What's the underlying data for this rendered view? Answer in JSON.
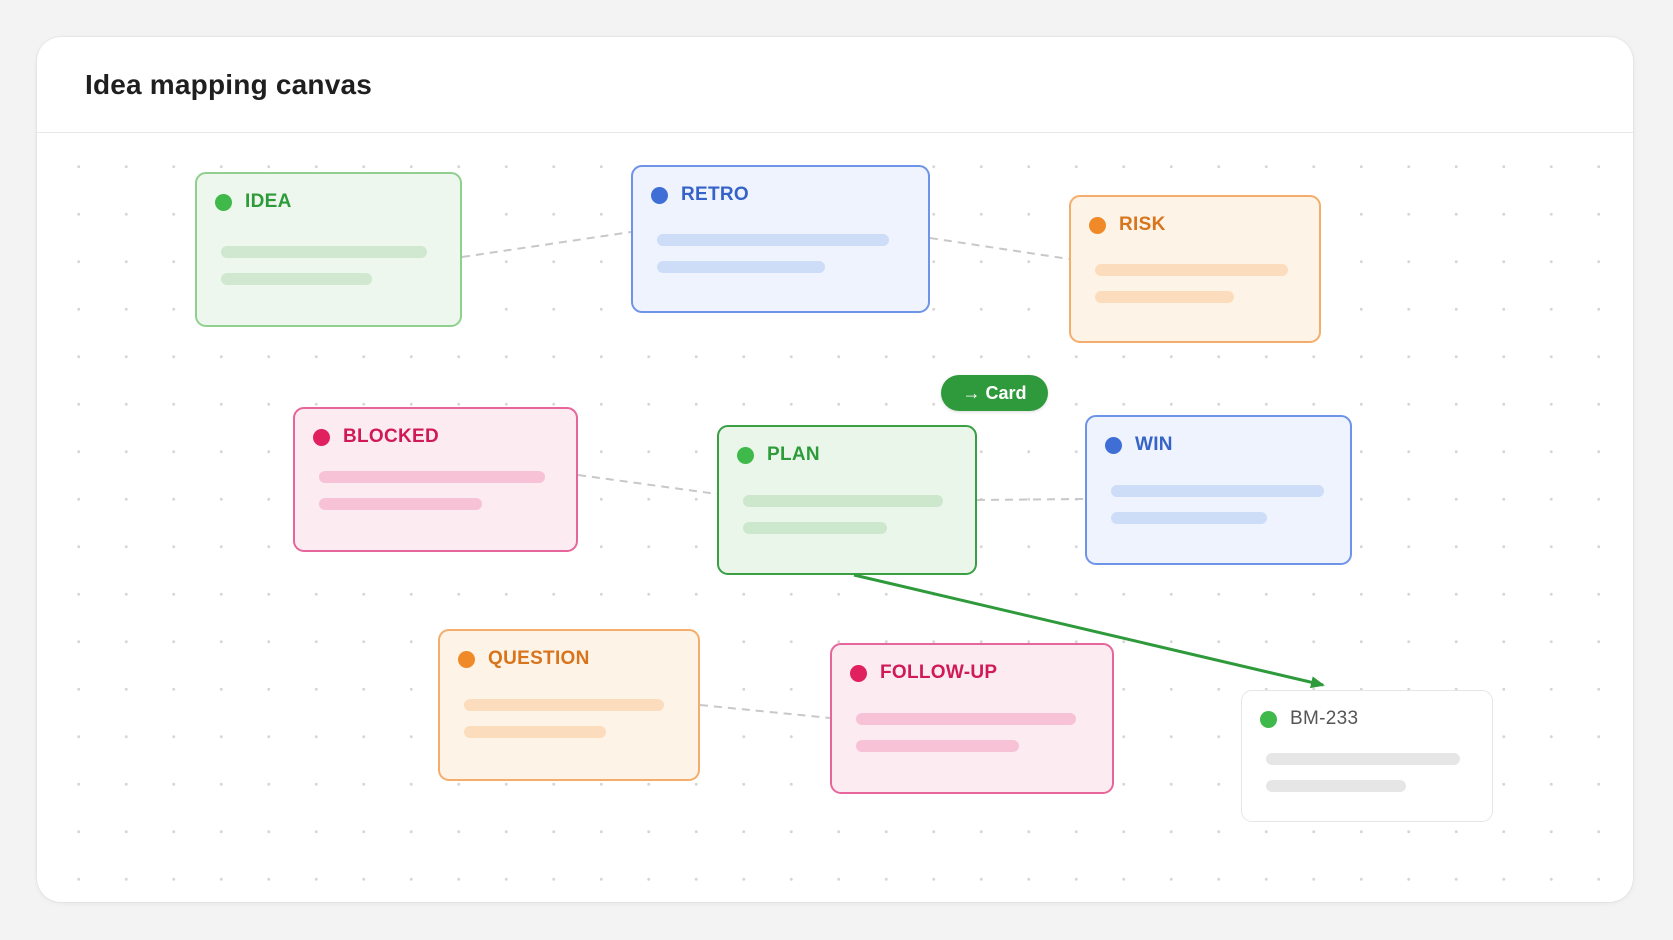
{
  "panel": {
    "title": "Idea mapping canvas"
  },
  "drag_chip": {
    "label": "→ Card"
  },
  "cards": {
    "idea": {
      "label": "IDEA",
      "color": "green"
    },
    "retro": {
      "label": "RETRO",
      "color": "blue"
    },
    "risk": {
      "label": "RISK",
      "color": "orange"
    },
    "blocked": {
      "label": "BLOCKED",
      "color": "pink"
    },
    "plan": {
      "label": "PLAN",
      "color": "green",
      "state": "selected"
    },
    "win": {
      "label": "WIN",
      "color": "blue"
    },
    "question": {
      "label": "QUESTION",
      "color": "orange"
    },
    "follow_up": {
      "label": "FOLLOW-UP",
      "color": "pink"
    },
    "target": {
      "label": "BM-233",
      "color": "neutral"
    }
  },
  "colors": {
    "green": "#3fb94a",
    "blue": "#3f6fd6",
    "orange": "#f08a28",
    "pink": "#e0205f",
    "arrow": "#2f9a3c",
    "connector": "#c8c8c8"
  }
}
